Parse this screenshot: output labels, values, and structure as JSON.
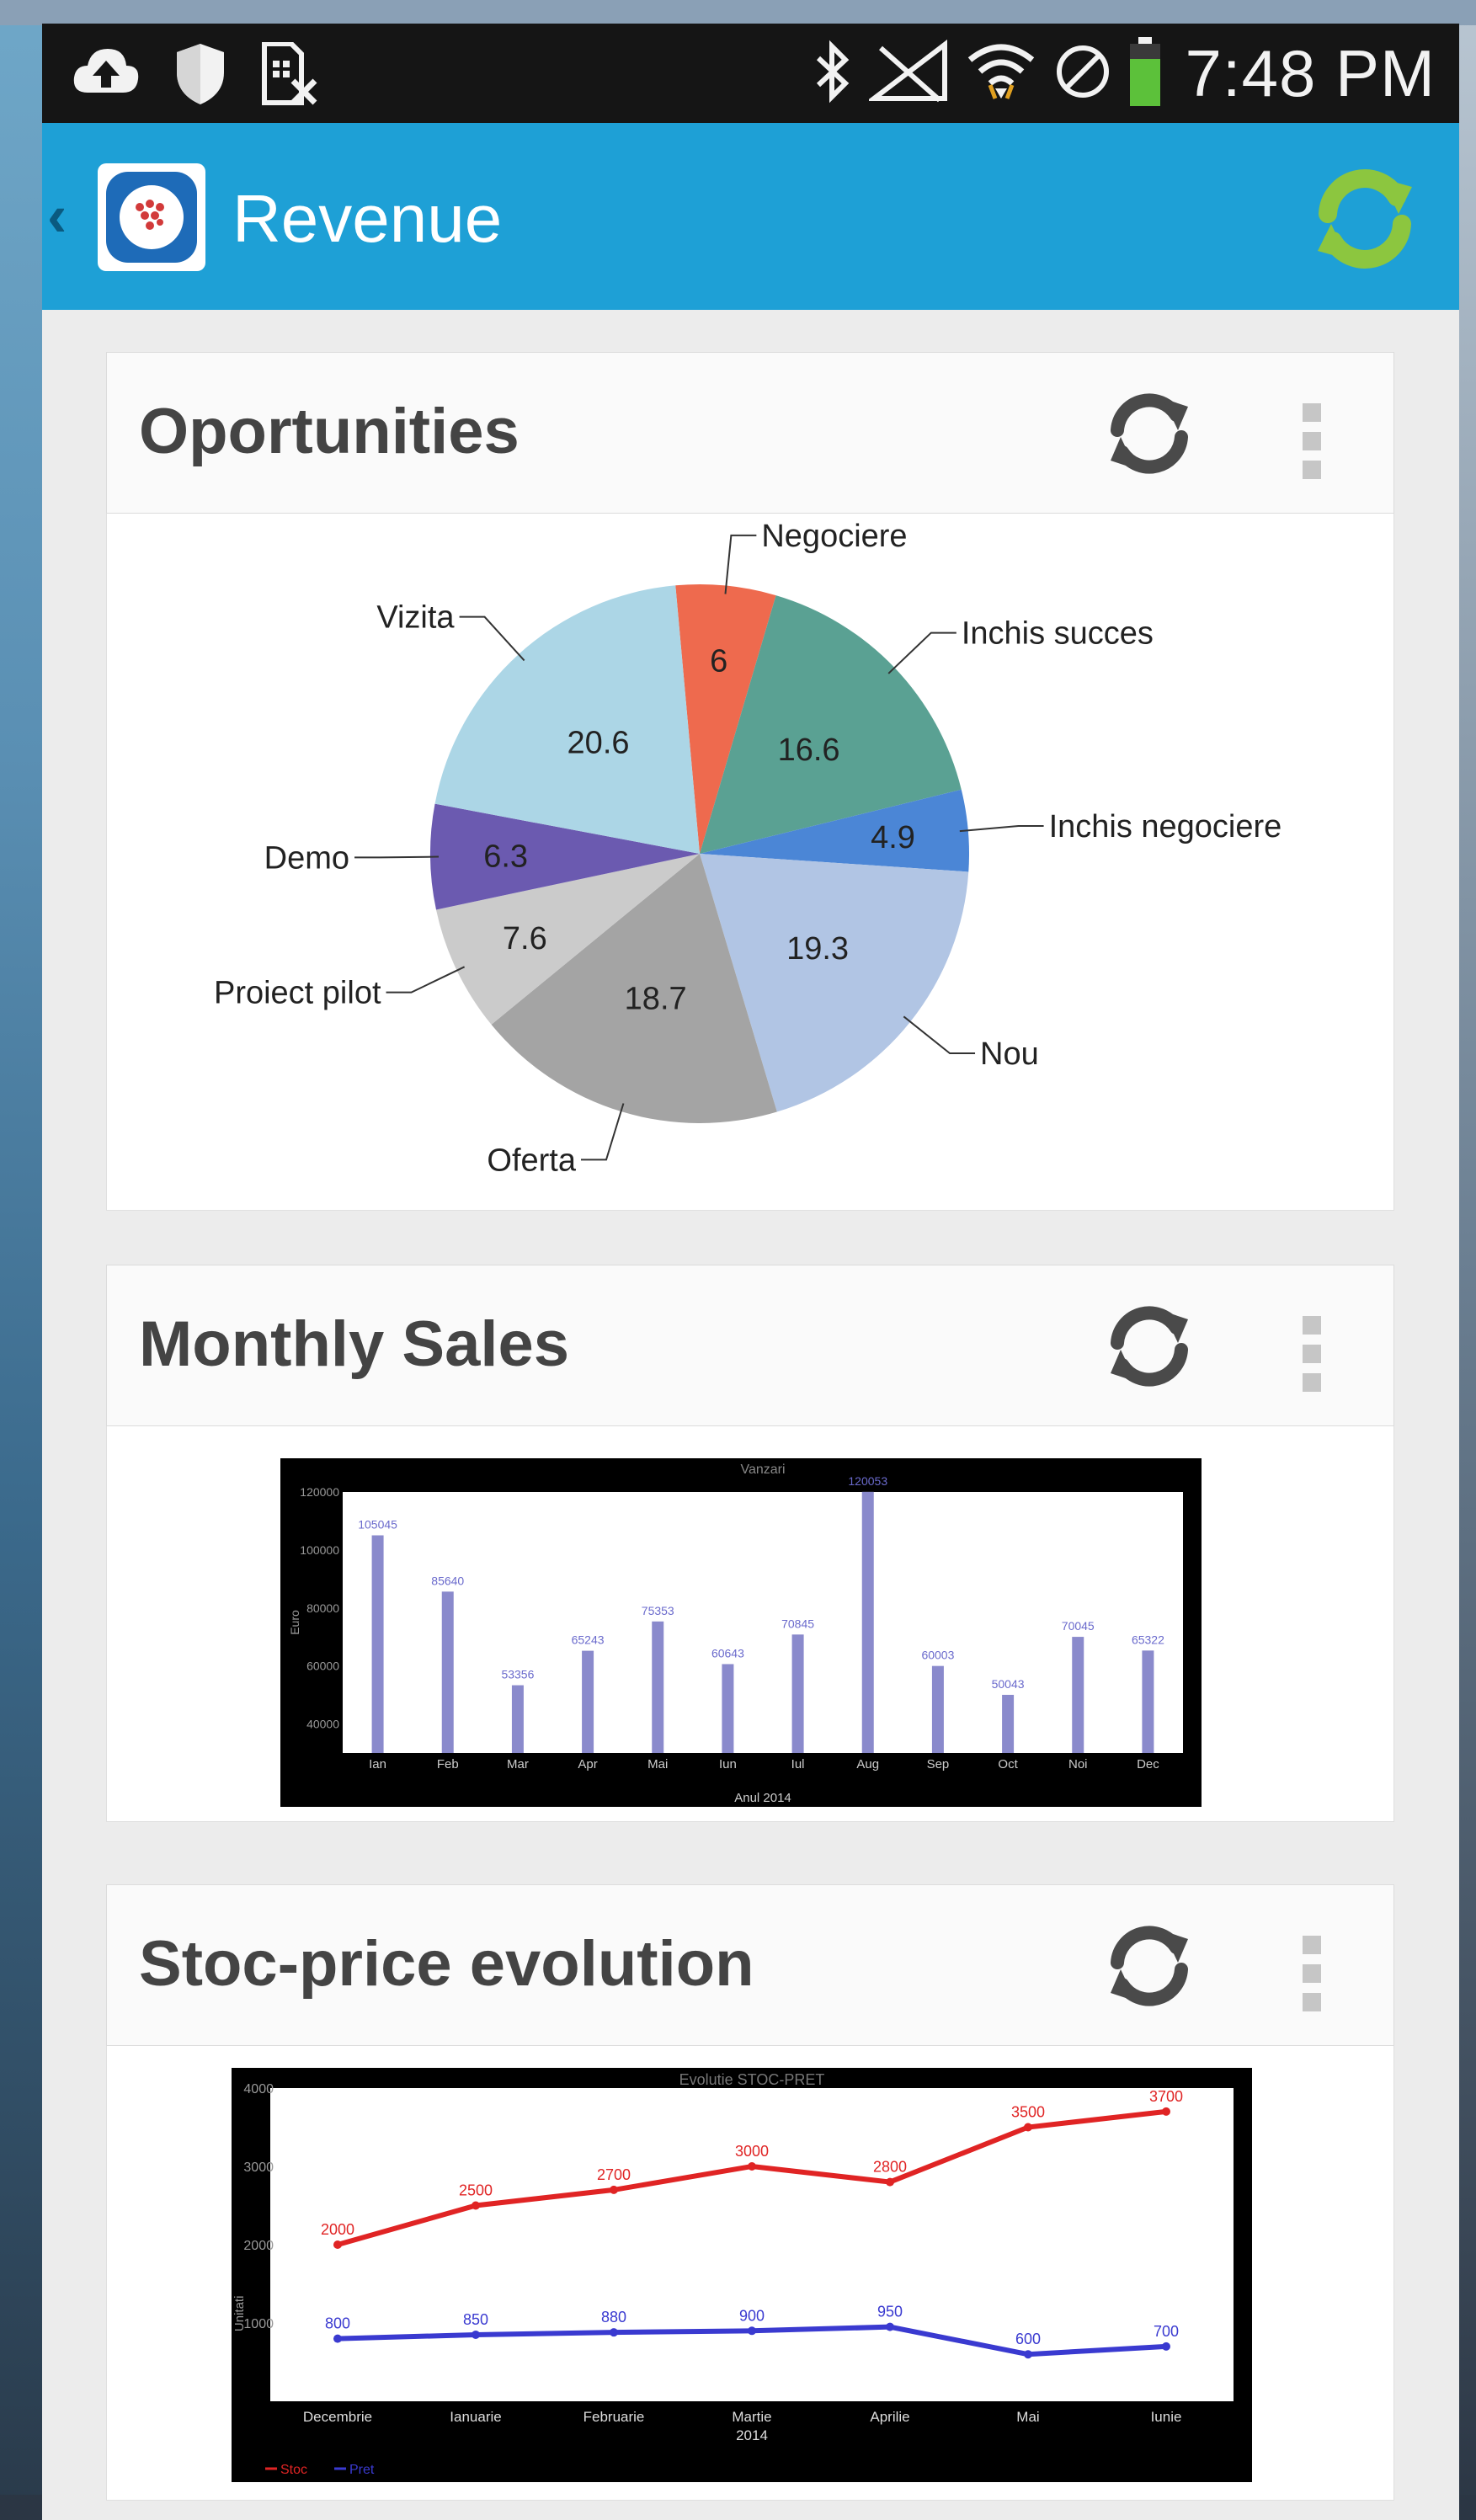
{
  "status_bar": {
    "time": "7:48 PM",
    "left_icons": [
      "cloud-upload-icon",
      "shield-icon",
      "sim-card-icon"
    ],
    "right_icons": [
      "bluetooth-icon",
      "no-signal-icon",
      "wifi-icon",
      "do-not-disturb-icon",
      "battery-icon"
    ]
  },
  "app_bar": {
    "title": "Revenue",
    "sync_color": "#8cc63f"
  },
  "cards": [
    {
      "title": "Oportunities"
    },
    {
      "title": "Monthly Sales"
    },
    {
      "title": "Stoc-price evolution"
    }
  ],
  "chart_data": [
    {
      "type": "pie",
      "slices": [
        {
          "label": "Negociere",
          "value": 6,
          "color": "#ee6a4e"
        },
        {
          "label": "Inchis succes",
          "value": 16.6,
          "color": "#5aa193"
        },
        {
          "label": "Inchis negociere",
          "value": 4.9,
          "color": "#4b86d6"
        },
        {
          "label": "Nou",
          "value": 19.3,
          "color": "#b1c5e4"
        },
        {
          "label": "Oferta",
          "value": 18.7,
          "color": "#a4a4a4"
        },
        {
          "label": "Proiect pilot",
          "value": 7.6,
          "color": "#cbcbcb"
        },
        {
          "label": "Demo",
          "value": 6.3,
          "color": "#6b5ab0"
        },
        {
          "label": "Vizita",
          "value": 20.6,
          "color": "#acd6e6"
        }
      ]
    },
    {
      "type": "bar",
      "title": "Vanzari",
      "xlabel": "Anul 2014",
      "ylabel": "Euro",
      "ylim": [
        30000,
        120000
      ],
      "yticks": [
        "40000",
        "60000",
        "80000",
        "100000",
        "120000"
      ],
      "categories": [
        "Ian",
        "Feb",
        "Mar",
        "Apr",
        "Mai",
        "Iun",
        "Iul",
        "Aug",
        "Sep",
        "Oct",
        "Noi",
        "Dec"
      ],
      "values": [
        105045,
        85640,
        53356,
        65243,
        75353,
        60643,
        70845,
        120053,
        60003,
        50043,
        70045,
        65322
      ],
      "color": "#8a8acc"
    },
    {
      "type": "line",
      "title": "Evolutie STOC-PRET",
      "xlabel": "2014",
      "ylabel": "Unitati",
      "ylim": [
        0,
        4000
      ],
      "yticks": [
        "1000",
        "2000",
        "3000",
        "4000"
      ],
      "categories": [
        "Decembrie",
        "Ianuarie",
        "Februarie",
        "Martie",
        "Aprilie",
        "Mai",
        "Iunie"
      ],
      "series": [
        {
          "name": "Stoc",
          "values": [
            2000,
            2500,
            2700,
            3000,
            2800,
            3500,
            3700
          ],
          "color": "#e02424"
        },
        {
          "name": "Pret",
          "values": [
            800,
            850,
            880,
            900,
            950,
            600,
            700
          ],
          "color": "#3a3ad0"
        }
      ],
      "legend": "bottom-left"
    }
  ]
}
